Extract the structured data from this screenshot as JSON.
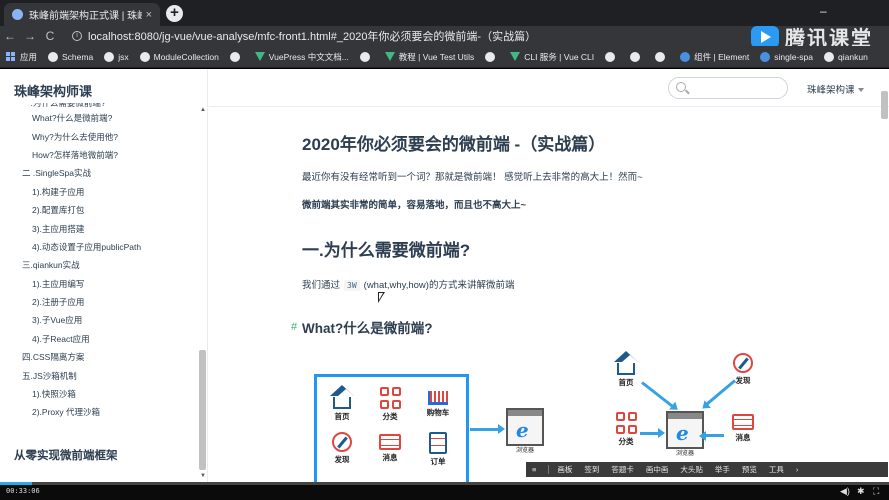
{
  "browser": {
    "tab_title": "珠峰前端架构正式课 | 珠峰构",
    "tab_close": "×",
    "new_tab": "+",
    "win_minimize": "–",
    "url": "localhost:8080/jg-vue/vue-analyse/mfc-front1.html#_2020年你必须要会的微前端-（实战篇）",
    "back": "←",
    "forward": "→",
    "reload": "C",
    "info": "i"
  },
  "watermark": {
    "text": "腾讯课堂"
  },
  "bookmarks": [
    {
      "label": "应用",
      "icon": "apps-grid-icon"
    },
    {
      "label": "Schema",
      "icon": "github-icon"
    },
    {
      "label": "jsx",
      "icon": "github-icon"
    },
    {
      "label": "ModuleCollection",
      "icon": "github-icon"
    },
    {
      "label": "",
      "icon": "github-icon"
    },
    {
      "label": "VuePress 中文文档...",
      "icon": "vue-icon"
    },
    {
      "label": "",
      "icon": "github-icon"
    },
    {
      "label": "教程 | Vue Test Utils",
      "icon": "vue-icon"
    },
    {
      "label": "",
      "icon": "github-icon"
    },
    {
      "label": "CLI 服务 | Vue CLI",
      "icon": "vue-icon"
    },
    {
      "label": "",
      "icon": "github-icon"
    },
    {
      "label": "",
      "icon": "github-icon"
    },
    {
      "label": "",
      "icon": "github-icon"
    },
    {
      "label": "组件 | Element",
      "icon": "element-icon"
    },
    {
      "label": "single-spa",
      "icon": "single-spa-icon"
    },
    {
      "label": "qiankun",
      "icon": "github-icon"
    }
  ],
  "sidebar": {
    "title": "珠峰架构师课",
    "items": [
      {
        "label": "一.为什么需要微前端?",
        "level": 1,
        "cut": true
      },
      {
        "label": "What?什么是微前端?",
        "level": 2
      },
      {
        "label": "Why?为什么去使用他?",
        "level": 2
      },
      {
        "label": "How?怎样落地微前端?",
        "level": 2
      },
      {
        "label": "二 .SingleSpa实战",
        "level": 1
      },
      {
        "label": "1).构建子应用",
        "level": 2
      },
      {
        "label": "2).配置库打包",
        "level": 2
      },
      {
        "label": "3).主应用搭建",
        "level": 2
      },
      {
        "label": "4).动态设置子应用publicPath",
        "level": 2
      },
      {
        "label": "三.qiankun实战",
        "level": 1
      },
      {
        "label": "1).主应用编写",
        "level": 2
      },
      {
        "label": "2).注册子应用",
        "level": 2
      },
      {
        "label": "3).子Vue应用",
        "level": 2
      },
      {
        "label": "4).子React应用",
        "level": 2
      },
      {
        "label": "四.CSS隔离方案",
        "level": 1
      },
      {
        "label": "五.JS沙箱机制",
        "level": 1
      },
      {
        "label": "1).快照沙箱",
        "level": 2
      },
      {
        "label": "2).Proxy 代理沙箱",
        "level": 2
      }
    ],
    "footer": "从零实现微前端框架",
    "scroll_up": "▲",
    "scroll_down": "▼"
  },
  "topbar": {
    "search_placeholder": "",
    "nav_label": "珠峰架构课"
  },
  "content": {
    "h1": "2020年你必须要会的微前端 -（实战篇）",
    "p1": "最近你有没有经常听到一个词？那就是微前端！ 感觉听上去非常的高大上！然而~",
    "p2": "微前端其实非常的简单，容易落地，而且也不高大上~",
    "h2": "一.为什么需要微前端?",
    "p3_before": "我们通过",
    "p3_code": "3W",
    "p3_after": "(what,why,how)的方式来讲解微前端",
    "h3_hash": "#",
    "h3": "What?什么是微前端?"
  },
  "diagram_left": {
    "icons": [
      {
        "label": "首页",
        "icon": "home-icon"
      },
      {
        "label": "分类",
        "icon": "category-icon"
      },
      {
        "label": "购物车",
        "icon": "cart-icon"
      },
      {
        "label": "发现",
        "icon": "compass-icon"
      },
      {
        "label": "消息",
        "icon": "message-icon"
      },
      {
        "label": "订单",
        "icon": "order-icon"
      }
    ],
    "browser_label": "浏览器"
  },
  "diagram_right": {
    "icons": [
      {
        "label": "首页",
        "icon": "home-icon"
      },
      {
        "label": "发现",
        "icon": "compass-icon"
      },
      {
        "label": "分类",
        "icon": "category-icon"
      },
      {
        "label": "消息",
        "icon": "message-icon"
      }
    ],
    "browser_label": "浏览器"
  },
  "floatbar": {
    "items": [
      "画板",
      "签到",
      "答题卡",
      "画中画",
      "大头贴",
      "举手",
      "预览",
      "工具"
    ],
    "left_glyph": "≡",
    "right_glyph": "›"
  },
  "video": {
    "time": "00:33:06",
    "progress": 0.036,
    "volume": "◀)",
    "settings": "✱",
    "fullscreen": "⛶"
  },
  "colors": {
    "accent": "#2196f3",
    "progress": "#2fa9e6",
    "hash": "#3eaf7c"
  }
}
